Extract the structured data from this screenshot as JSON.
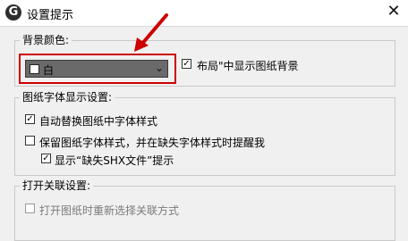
{
  "window": {
    "title": "设置提示",
    "app_icon": "G",
    "close_glyph": "✕"
  },
  "background_group": {
    "label": "背景颜色:",
    "dropdown_value": "白",
    "swatch_color": "#ffffff",
    "layout_checkbox_label": "布局\"中显示图纸背景",
    "layout_checkbox_checked": true
  },
  "font_group": {
    "label": "图纸字体显示设置:",
    "auto_replace_label": "自动替换图纸中字体样式",
    "auto_replace_checked": true,
    "keep_style_label": "保留图纸字体样式，并在缺失字体样式时提醒我",
    "keep_style_checked": false,
    "show_shx_label": "显示“缺失SHX文件”提示",
    "show_shx_checked": true
  },
  "open_group": {
    "label": "打开关联设置:",
    "reselect_label": "打开图纸时重新选择关联方式",
    "reselect_checked": false
  },
  "annotation": {
    "highlight_color": "#cc0000"
  }
}
